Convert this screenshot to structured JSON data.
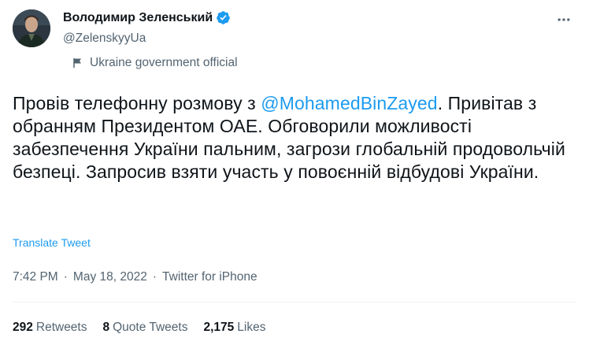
{
  "author": {
    "display_name": "Володимир Зеленський",
    "handle": "@ZelenskyyUa",
    "label": "Ukraine government official"
  },
  "tweet": {
    "text_before": "Провів телефонну розмову з ",
    "mention": "@MohamedBinZayed",
    "text_after": ". Привітав з обранням Президентом ОАЕ. Обговорили можливості забезпечення України пальним, загрози глобальній продовольчій безпеці. Запросив взяти участь у повоєнній відбудові України.",
    "translate_label": "Translate Tweet"
  },
  "meta": {
    "time": "7:42 PM",
    "separator": "·",
    "date": "May 18, 2022",
    "source": "Twitter for iPhone"
  },
  "stats": {
    "retweets_count": "292",
    "retweets_label": "Retweets",
    "quotes_count": "8",
    "quotes_label": "Quote Tweets",
    "likes_count": "2,175",
    "likes_label": "Likes"
  },
  "colors": {
    "accent": "#1d9bf0",
    "secondary_text": "#536471",
    "primary_text": "#0f1419"
  },
  "icons": {
    "verified": "verified-badge-icon",
    "label": "flag-icon",
    "more": "more-horizontal-icon"
  }
}
